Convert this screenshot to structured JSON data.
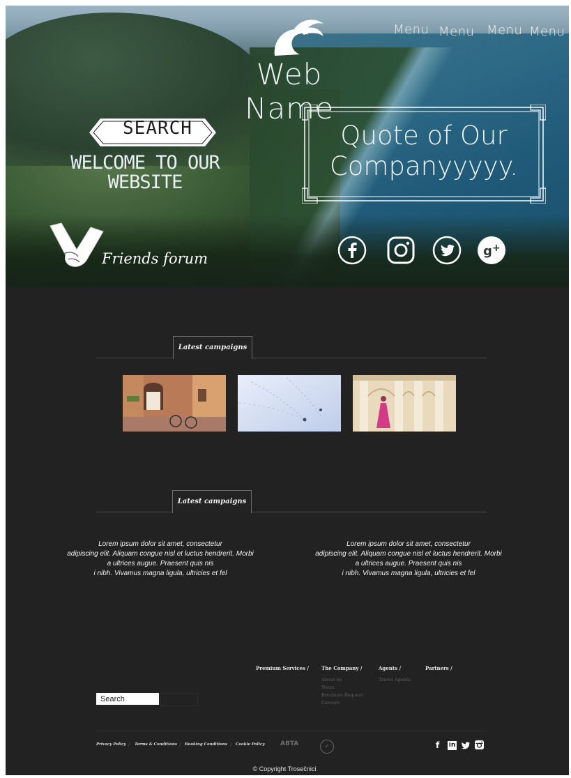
{
  "header": {
    "menu_items": [
      "Menu",
      "Menu",
      "Menu",
      "Menu"
    ],
    "site_name": "Web Name",
    "search_badge": "SEARCH",
    "welcome_line1": "WELCOME TO OUR",
    "welcome_line2": "WEBSITE",
    "quote_line1": "Quote of Our",
    "quote_line2": "Companyyyyy.",
    "forum_label": "Friends forum",
    "social_icons": [
      "facebook-icon",
      "instagram-icon",
      "twitter-icon",
      "google-plus-icon"
    ]
  },
  "campaigns": {
    "tab_label": "Latest campaigns",
    "images": [
      "italian-street-photo",
      "snow-footprints-photo",
      "arches-woman-photo"
    ]
  },
  "news": {
    "tab_label": "Latest campaigns",
    "paragraphs": [
      {
        "line1": "Lorem ipsum dolor sit amet, consectetur",
        "line2": "adipiscing elit. Aliquam congue nisl et luctus hendrerit. Morbi",
        "line3": "a ultrices augue. Praesent quis nis",
        "line4": "i nibh. Vivamus magna ligula, ultricies et fel"
      },
      {
        "line1": "Lorem ipsum dolor sit amet, consectetur",
        "line2": "adipiscing elit. Aliquam congue nisl et luctus hendrerit. Morbi",
        "line3": "a ultrices augue. Praesent quis nis",
        "line4": "i nibh. Vivamus magna ligula, ultricies et fel"
      }
    ]
  },
  "footer": {
    "search_value": "Search",
    "columns": [
      {
        "heading": "Premium Services /",
        "links": []
      },
      {
        "heading": "The Company /",
        "links": [
          "About us",
          "News",
          "Brochure Request",
          "Careers"
        ]
      },
      {
        "heading": "Agents /",
        "links": [
          "Travel Agents"
        ]
      },
      {
        "heading": "Partners /",
        "links": []
      }
    ],
    "legal_links": [
      "Privacy Policy",
      "Terms & Conditions",
      "Booking Conditions",
      "Cookie Policy"
    ],
    "legal_separator": "/",
    "abta_label": "ABTA",
    "social": [
      "f",
      "in",
      "t",
      "ig"
    ],
    "copyright": "© Copyright Trosečnici"
  }
}
